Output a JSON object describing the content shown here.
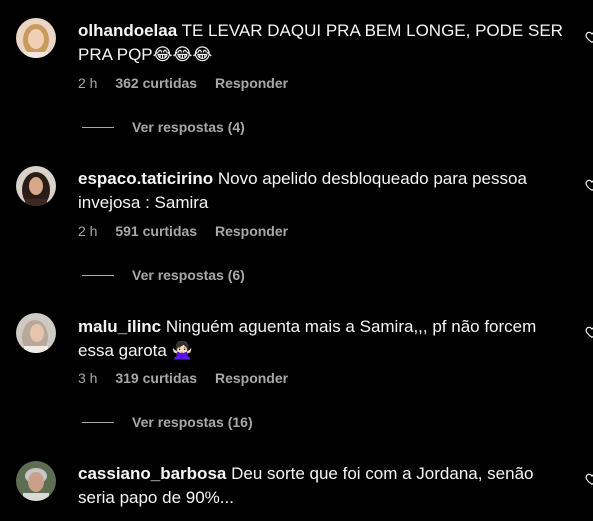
{
  "comments": [
    {
      "username": "olhandoelaa",
      "text": "TE LEVAR DAQUI PRA BEM LONGE, PODE SER PRA PQP😂😂😂",
      "time": "2 h",
      "likes": "362 curtidas",
      "reply": "Responder",
      "view_replies": "Ver respostas (4)",
      "avatar_icon": "avatar-photo-woman-blonde"
    },
    {
      "username": "espaco.taticirino",
      "text": "Novo apelido desbloqueado para pessoa invejosa : Samira",
      "time": "2 h",
      "likes": "591 curtidas",
      "reply": "Responder",
      "view_replies": "Ver respostas (6)",
      "avatar_icon": "avatar-photo-woman-dark-hair"
    },
    {
      "username": "malu_ilinc",
      "text": "Ninguém aguenta mais a Samira,,, pf não forcem essa garota 🙅🏻‍♀️",
      "time": "3 h",
      "likes": "319 curtidas",
      "reply": "Responder",
      "view_replies": "Ver respostas (16)",
      "avatar_icon": "avatar-photo-woman-light-hair"
    },
    {
      "username": "cassiano_barbosa",
      "text": "Deu sorte que foi com a Jordana, senão seria papo de 90%...",
      "avatar_icon": "avatar-photo-man-gray-hair"
    }
  ],
  "colors": {
    "background": "#000000",
    "text": "#f5f5f5",
    "secondary": "#a8a8a8"
  },
  "icons": {
    "like": "heart-outline-icon"
  }
}
